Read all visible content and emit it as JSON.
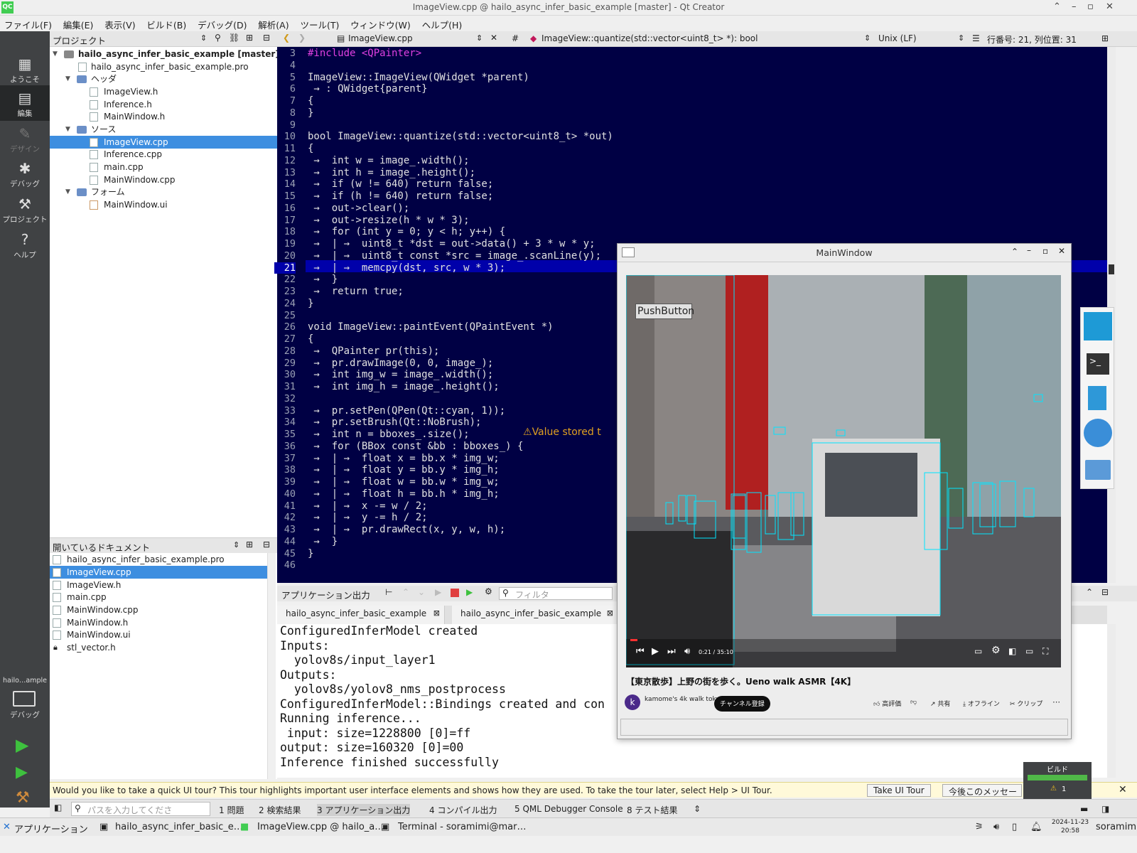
{
  "window": {
    "title": "ImageView.cpp @ hailo_async_infer_basic_example [master] - Qt Creator",
    "app_icon": "QC"
  },
  "menu": [
    "ファイル(F)",
    "編集(E)",
    "表示(V)",
    "ビルド(B)",
    "デバッグ(D)",
    "解析(A)",
    "ツール(T)",
    "ウィンドウ(W)",
    "ヘルプ(H)"
  ],
  "modes": [
    {
      "label": "ようこそ",
      "icon": "grid-icon"
    },
    {
      "label": "編集",
      "icon": "edit-doc-icon"
    },
    {
      "label": "デザイン",
      "icon": "pen-icon"
    },
    {
      "label": "デバッグ",
      "icon": "bug-icon"
    },
    {
      "label": "プロジェクト",
      "icon": "wrench-icon"
    },
    {
      "label": "ヘルプ",
      "icon": "help-icon"
    }
  ],
  "kit": {
    "name": "hailo…ample",
    "label": "デバッグ"
  },
  "project_panel": {
    "title": "プロジェクト",
    "root": "hailo_async_infer_basic_example [master]",
    "pro_file": "hailo_async_infer_basic_example.pro",
    "headers_label": "ヘッダ",
    "headers": [
      "ImageView.h",
      "Inference.h",
      "MainWindow.h"
    ],
    "sources_label": "ソース",
    "sources": [
      "ImageView.cpp",
      "Inference.cpp",
      "main.cpp",
      "MainWindow.cpp"
    ],
    "forms_label": "フォーム",
    "forms": [
      "MainWindow.ui"
    ]
  },
  "open_docs": {
    "title": "開いているドキュメント",
    "items": [
      "hailo_async_infer_basic_example.pro",
      "ImageView.cpp",
      "ImageView.h",
      "main.cpp",
      "MainWindow.cpp",
      "MainWindow.h",
      "MainWindow.ui",
      "stl_vector.h"
    ]
  },
  "editor": {
    "file": "ImageView.cpp",
    "symbol": "ImageView::quantize(std::vector<uint8_t> *): bool",
    "line_ending": "Unix (LF)",
    "position": "行番号: 21, 列位置: 31",
    "warning": "Value stored t",
    "lines": [
      {
        "n": "3",
        "t": "#include <QPainter>"
      },
      {
        "n": "4",
        "t": ""
      },
      {
        "n": "5",
        "t": "ImageView::ImageView(QWidget *parent)"
      },
      {
        "n": "6",
        "t": " → : QWidget{parent}"
      },
      {
        "n": "7",
        "t": "{"
      },
      {
        "n": "8",
        "t": "}"
      },
      {
        "n": "9",
        "t": ""
      },
      {
        "n": "10",
        "t": "bool ImageView::quantize(std::vector<uint8_t> *out)"
      },
      {
        "n": "11",
        "t": "{"
      },
      {
        "n": "12",
        "t": " →  int w = image_.width();"
      },
      {
        "n": "13",
        "t": " →  int h = image_.height();"
      },
      {
        "n": "14",
        "t": " →  if (w != 640) return false;"
      },
      {
        "n": "15",
        "t": " →  if (h != 640) return false;"
      },
      {
        "n": "16",
        "t": " →  out->clear();"
      },
      {
        "n": "17",
        "t": " →  out->resize(h * w * 3);"
      },
      {
        "n": "18",
        "t": " →  for (int y = 0; y < h; y++) {"
      },
      {
        "n": "19",
        "t": " →  | →  uint8_t *dst = out->data() + 3 * w * y;"
      },
      {
        "n": "20",
        "t": " →  | →  uint8_t const *src = image_.scanLine(y);"
      },
      {
        "n": "21",
        "t": " →  | →  memcpy(dst, src, w * 3);"
      },
      {
        "n": "22",
        "t": " →  }"
      },
      {
        "n": "23",
        "t": " →  return true;"
      },
      {
        "n": "24",
        "t": "}"
      },
      {
        "n": "25",
        "t": ""
      },
      {
        "n": "26",
        "t": "void ImageView::paintEvent(QPaintEvent *)"
      },
      {
        "n": "27",
        "t": "{"
      },
      {
        "n": "28",
        "t": " →  QPainter pr(this);"
      },
      {
        "n": "29",
        "t": " →  pr.drawImage(0, 0, image_);"
      },
      {
        "n": "30",
        "t": " →  int img_w = image_.width();"
      },
      {
        "n": "31",
        "t": " →  int img_h = image_.height();"
      },
      {
        "n": "32",
        "t": ""
      },
      {
        "n": "33",
        "t": " →  pr.setPen(QPen(Qt::cyan, 1));"
      },
      {
        "n": "34",
        "t": " →  pr.setBrush(Qt::NoBrush);"
      },
      {
        "n": "35",
        "t": " →  int n = bboxes_.size();"
      },
      {
        "n": "36",
        "t": " →  for (BBox const &bb : bboxes_) {"
      },
      {
        "n": "37",
        "t": " →  | →  float x = bb.x * img_w;"
      },
      {
        "n": "38",
        "t": " →  | →  float y = bb.y * img_h;"
      },
      {
        "n": "39",
        "t": " →  | →  float w = bb.w * img_w;"
      },
      {
        "n": "40",
        "t": " →  | →  float h = bb.h * img_h;"
      },
      {
        "n": "41",
        "t": " →  | →  x -= w / 2;"
      },
      {
        "n": "42",
        "t": " →  | →  y -= h / 2;"
      },
      {
        "n": "43",
        "t": " →  | →  pr.drawRect(x, y, w, h);"
      },
      {
        "n": "44",
        "t": " →  }"
      },
      {
        "n": "45",
        "t": "}"
      },
      {
        "n": "46",
        "t": ""
      }
    ]
  },
  "output_panel": {
    "title": "アプリケーション出力",
    "filter_placeholder": "フィルタ",
    "tabs": [
      "hailo_async_infer_basic_example",
      "hailo_async_infer_basic_example"
    ],
    "lines": [
      "ConfiguredInferModel created",
      "Inputs:",
      "  yolov8s/input_layer1",
      "Outputs:",
      "  yolov8s/yolov8_nms_postprocess",
      "ConfiguredInferModel::Bindings created and con",
      "Running inference...",
      " input: size=1228800 [0]=ff",
      "output: size=160320 [0]=00",
      "Inference finished successfully"
    ]
  },
  "main_window": {
    "title": "MainWindow",
    "button": "PushButton",
    "video_title": "【東京散歩】上野の街を歩く。Ueno walk ASMR【4K】",
    "channel": "kamome's 4k walk tokyo",
    "subscribe": "チャンネル登録",
    "time": "0:21 / 35:10",
    "actions": [
      "高評価",
      "共有",
      "オフライン",
      "クリップ"
    ],
    "bbox_color": "#00e5ff"
  },
  "tour_bar": {
    "message": "Would you like to take a quick UI tour? This tour highlights important user interface elements and shows how they are used. To take the tour later, select Help > UI Tour.",
    "take_tour": "Take UI Tour",
    "later": "今後このメッセー"
  },
  "status_bar": {
    "locator_placeholder": "パスを入力してくださ",
    "tabs": [
      "1 問題",
      "2 検索結果",
      "3 アプリケーション出力",
      "4 コンパイル出力",
      "5 QML Debugger Console",
      "8 テスト結果"
    ]
  },
  "build_indicator": {
    "label": "ビルド",
    "warnings": "1"
  },
  "taskbar": {
    "start": "アプリケーション",
    "items": [
      "hailo_async_infer_basic_e…",
      "ImageView.cpp @ hailo_a…",
      "Terminal - soramimi@mar…"
    ],
    "date": "2024-11-23",
    "time": "20:58",
    "user": "soramimi"
  }
}
